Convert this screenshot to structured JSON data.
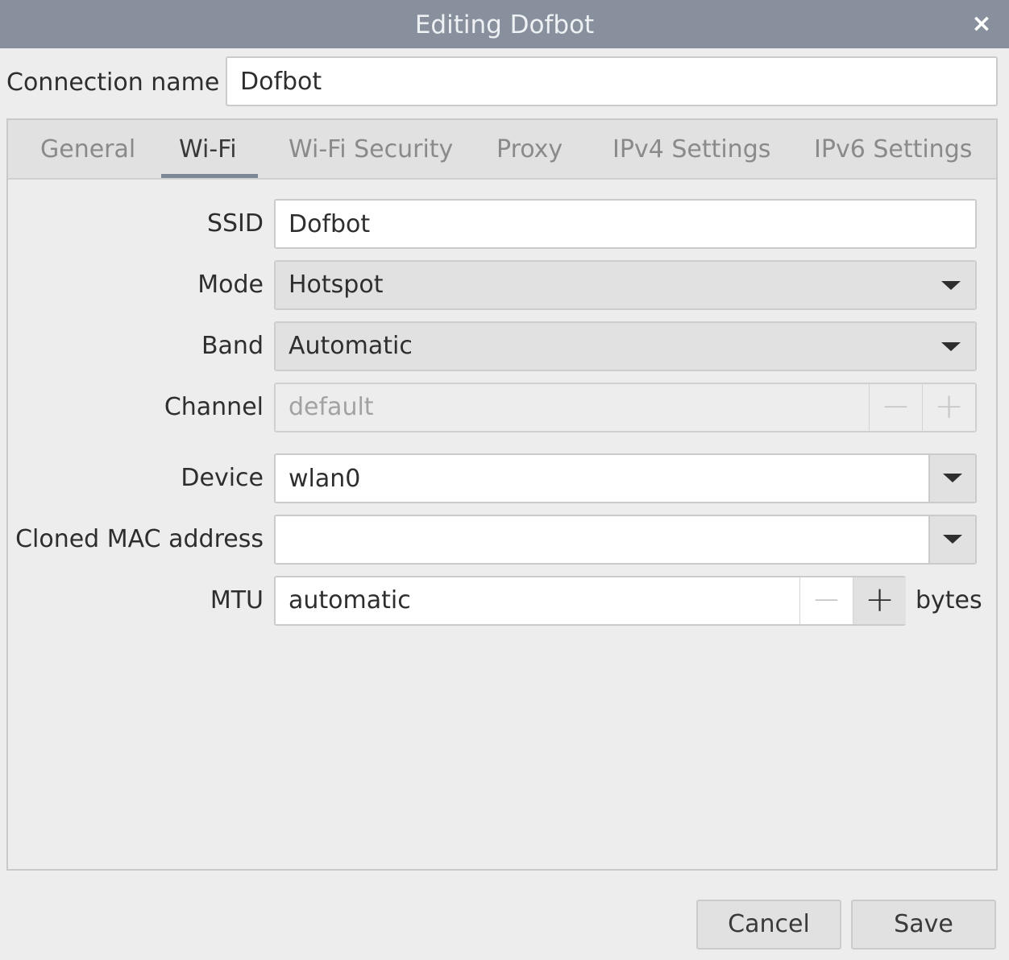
{
  "window": {
    "title": "Editing Dofbot",
    "close_glyph": "×"
  },
  "connection": {
    "label": "Connection name",
    "value": "Dofbot"
  },
  "tabs": [
    {
      "label": "General",
      "active": false
    },
    {
      "label": "Wi-Fi",
      "active": true
    },
    {
      "label": "Wi-Fi Security",
      "active": false
    },
    {
      "label": "Proxy",
      "active": false
    },
    {
      "label": "IPv4 Settings",
      "active": false
    },
    {
      "label": "IPv6 Settings",
      "active": false
    }
  ],
  "wifi": {
    "ssid": {
      "label": "SSID",
      "value": "Dofbot"
    },
    "mode": {
      "label": "Mode",
      "value": "Hotspot"
    },
    "band": {
      "label": "Band",
      "value": "Automatic"
    },
    "channel": {
      "label": "Channel",
      "value": "default",
      "minus": "−",
      "plus": "+"
    },
    "device": {
      "label": "Device",
      "value": "wlan0"
    },
    "cloned_mac": {
      "label": "Cloned MAC address",
      "value": ""
    },
    "mtu": {
      "label": "MTU",
      "value": "automatic",
      "minus": "−",
      "plus": "+",
      "unit": "bytes"
    }
  },
  "buttons": {
    "cancel": "Cancel",
    "save": "Save"
  },
  "colors": {
    "titlebar": "#87909c",
    "tab_indicator": "#7c8796"
  },
  "icons": {
    "close": "close-icon",
    "dropdown": "chevron-down-icon"
  }
}
